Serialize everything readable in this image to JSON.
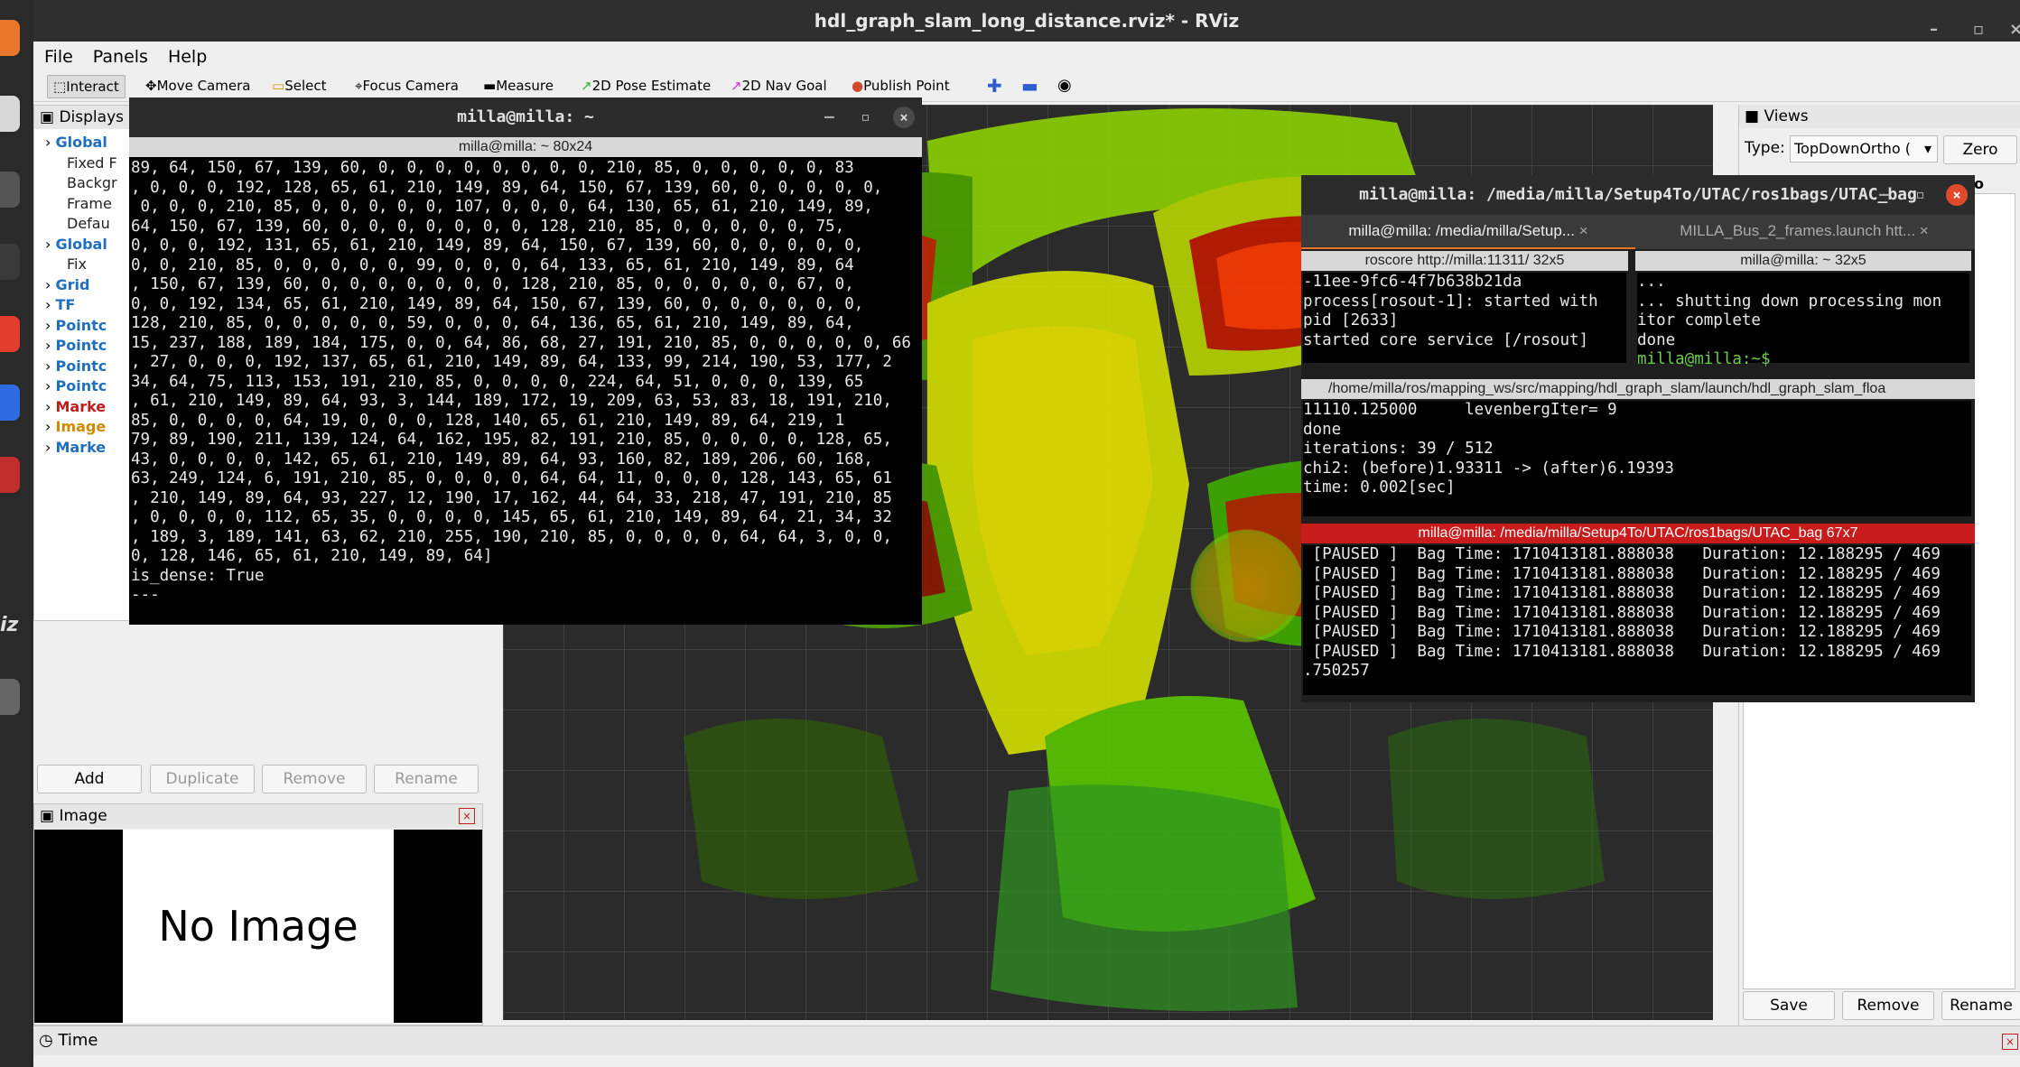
{
  "window": {
    "title": "hdl_graph_slam_long_distance.rviz* - RViz"
  },
  "menu": [
    "File",
    "Panels",
    "Help"
  ],
  "toolbar": {
    "interact": "Interact",
    "move_camera": "Move Camera",
    "select": "Select",
    "focus_camera": "Focus Camera",
    "measure": "Measure",
    "pose_estimate": "2D Pose Estimate",
    "nav_goal": "2D Nav Goal",
    "publish_point": "Publish Point"
  },
  "displays": {
    "title": "Displays",
    "items": [
      {
        "label": "Global",
        "indent": 1
      },
      {
        "label": "Fixed F",
        "indent": 2
      },
      {
        "label": "Backgr",
        "indent": 2
      },
      {
        "label": "Frame",
        "indent": 2
      },
      {
        "label": "Defau",
        "indent": 2
      },
      {
        "label": "Global",
        "indent": 1
      },
      {
        "label": "Fix",
        "indent": 2
      },
      {
        "label": "Grid",
        "indent": 1
      },
      {
        "label": "TF",
        "indent": 1
      },
      {
        "label": "Pointc",
        "indent": 1
      },
      {
        "label": "Pointc",
        "indent": 1
      },
      {
        "label": "Pointc",
        "indent": 1
      },
      {
        "label": "Pointc",
        "indent": 1
      },
      {
        "label": "Marke",
        "indent": 1
      },
      {
        "label": "Image",
        "indent": 1
      },
      {
        "label": "Marke",
        "indent": 1
      }
    ],
    "buttons": {
      "add": "Add",
      "duplicate": "Duplicate",
      "remove": "Remove",
      "rename": "Rename"
    }
  },
  "image_panel": {
    "title": "Image",
    "placeholder": "No Image"
  },
  "time_panel": {
    "title": "Time"
  },
  "views": {
    "title": "Views",
    "type_label": "Type:",
    "type_value": "TopDownOrtho (",
    "zero": "Zero",
    "partial": "o (rviz",
    "buttons": {
      "save": "Save",
      "remove": "Remove",
      "rename": "Rename"
    }
  },
  "term1": {
    "title": "milla@milla: ~",
    "subtitle": "milla@milla: ~ 80x24",
    "lines": [
      "89, 64, 150, 67, 139, 60, 0, 0, 0, 0, 0, 0, 0, 0, 210, 85, 0, 0, 0, 0, 0, 83",
      ", 0, 0, 0, 192, 128, 65, 61, 210, 149, 89, 64, 150, 67, 139, 60, 0, 0, 0, 0, 0,",
      " 0, 0, 0, 210, 85, 0, 0, 0, 0, 0, 107, 0, 0, 0, 64, 130, 65, 61, 210, 149, 89,",
      "64, 150, 67, 139, 60, 0, 0, 0, 0, 0, 0, 0, 128, 210, 85, 0, 0, 0, 0, 0, 75,",
      "0, 0, 0, 192, 131, 65, 61, 210, 149, 89, 64, 150, 67, 139, 60, 0, 0, 0, 0, 0,",
      "0, 0, 210, 85, 0, 0, 0, 0, 0, 99, 0, 0, 0, 64, 133, 65, 61, 210, 149, 89, 64",
      ", 150, 67, 139, 60, 0, 0, 0, 0, 0, 0, 0, 128, 210, 85, 0, 0, 0, 0, 0, 67, 0,",
      "0, 0, 192, 134, 65, 61, 210, 149, 89, 64, 150, 67, 139, 60, 0, 0, 0, 0, 0, 0,",
      "128, 210, 85, 0, 0, 0, 0, 0, 59, 0, 0, 0, 64, 136, 65, 61, 210, 149, 89, 64,",
      "15, 237, 188, 189, 184, 175, 0, 0, 64, 86, 68, 27, 191, 210, 85, 0, 0, 0, 0, 0, 66",
      ", 27, 0, 0, 0, 192, 137, 65, 61, 210, 149, 89, 64, 133, 99, 214, 190, 53, 177, 2",
      "34, 64, 75, 113, 153, 191, 210, 85, 0, 0, 0, 0, 224, 64, 51, 0, 0, 0, 139, 65",
      ", 61, 210, 149, 89, 64, 93, 3, 144, 189, 172, 19, 209, 63, 53, 83, 18, 191, 210,",
      "85, 0, 0, 0, 0, 64, 19, 0, 0, 0, 128, 140, 65, 61, 210, 149, 89, 64, 219, 1",
      "79, 89, 190, 211, 139, 124, 64, 162, 195, 82, 191, 210, 85, 0, 0, 0, 0, 128, 65,",
      "43, 0, 0, 0, 0, 142, 65, 61, 210, 149, 89, 64, 93, 160, 82, 189, 206, 60, 168,",
      "63, 249, 124, 6, 191, 210, 85, 0, 0, 0, 0, 64, 64, 11, 0, 0, 0, 128, 143, 65, 61",
      ", 210, 149, 89, 64, 93, 227, 12, 190, 17, 162, 44, 64, 33, 218, 47, 191, 210, 85",
      ", 0, 0, 0, 0, 112, 65, 35, 0, 0, 0, 0, 145, 65, 61, 210, 149, 89, 64, 21, 34, 32",
      ", 189, 3, 189, 141, 63, 62, 210, 255, 190, 210, 85, 0, 0, 0, 0, 64, 64, 3, 0, 0,",
      "0, 128, 146, 65, 61, 210, 149, 89, 64]",
      "is_dense: True",
      "---"
    ]
  },
  "term2": {
    "title": "milla@milla: /media/milla/Setup4To/UTAC/ros1bags/UTAC_bag",
    "tab1": "milla@milla: /media/milla/Setup...",
    "tab2": "MILLA_Bus_2_frames.launch htt...",
    "pane1_head": "roscore http://milla:11311/ 32x5",
    "pane1_lines": [
      "-11ee-9fc6-4f7b638b21da",
      "process[rosout-1]: started with",
      "pid [2633]",
      "started core service [/rosout]"
    ],
    "pane2_head": "milla@milla: ~ 32x5",
    "pane2_lines": [
      "...",
      "... shutting down processing mon",
      "itor complete",
      "done"
    ],
    "pane2_prompt": "milla@milla:~$ ",
    "pane3_head": "/home/milla/ros/mapping_ws/src/mapping/hdl_graph_slam/launch/hdl_graph_slam_floa",
    "pane3_lines": [
      "11110.125000     levenbergIter= 9",
      "done",
      "iterations: 39 / 512",
      "chi2: (before)1.93311 -> (after)6.19393",
      "time: 0.002[sec]"
    ],
    "pane4_head": "milla@milla: /media/milla/Setup4To/UTAC/ros1bags/UTAC_bag 67x7",
    "pane4_lines": [
      " [PAUSED ]  Bag Time: 1710413181.888038   Duration: 12.188295 / 469",
      " [PAUSED ]  Bag Time: 1710413181.888038   Duration: 12.188295 / 469",
      " [PAUSED ]  Bag Time: 1710413181.888038   Duration: 12.188295 / 469",
      " [PAUSED ]  Bag Time: 1710413181.888038   Duration: 12.188295 / 469",
      " [PAUSED ]  Bag Time: 1710413181.888038   Duration: 12.188295 / 469",
      " [PAUSED ]  Bag Time: 1710413181.888038   Duration: 12.188295 / 469",
      ".750257"
    ]
  },
  "dock": {
    "label": "iz"
  }
}
